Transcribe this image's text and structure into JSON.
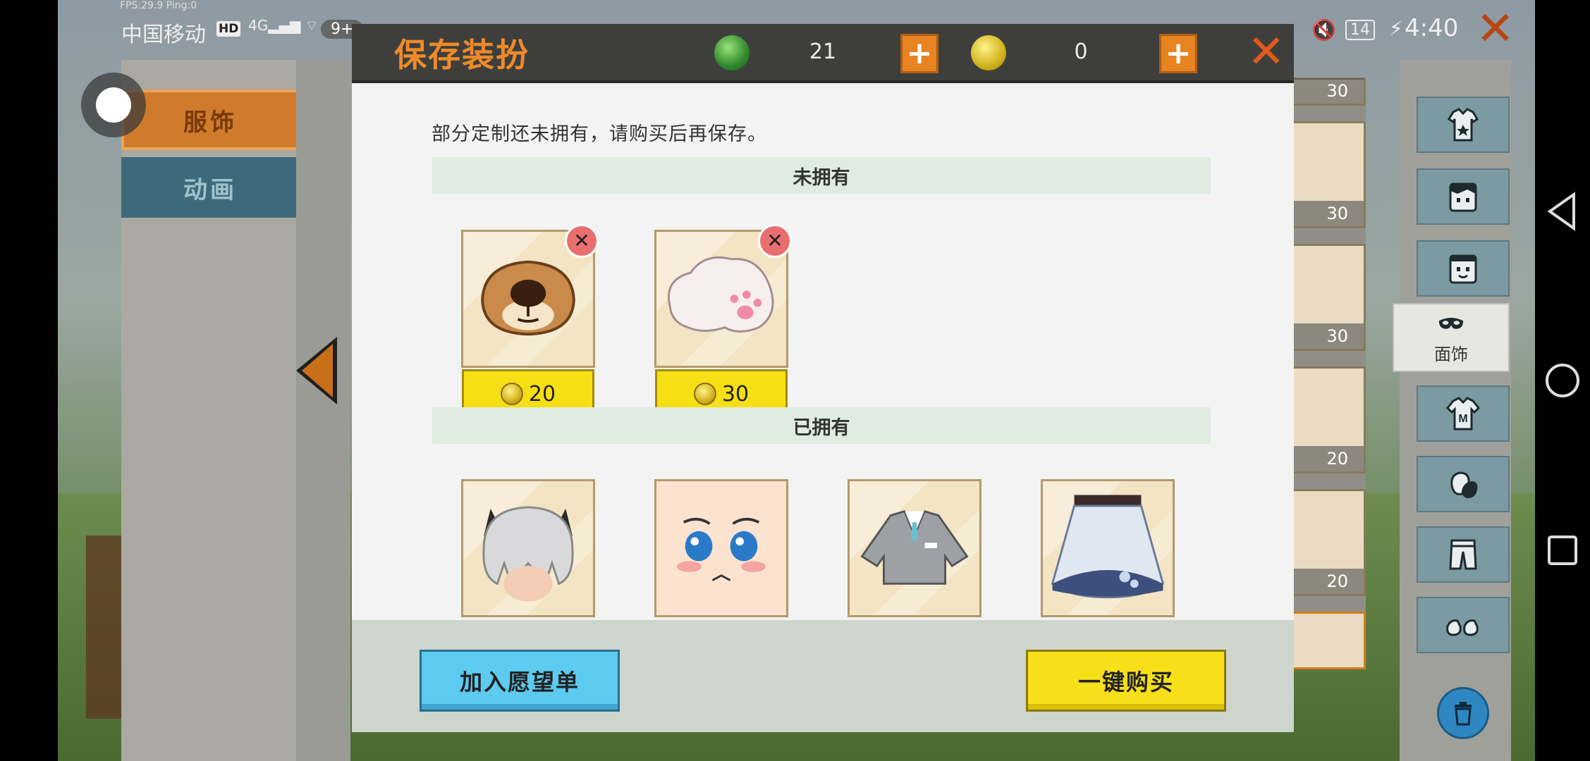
{
  "status_bar": {
    "fps": "FPS:29.9  Ping:0",
    "carrier": "中国移动",
    "hd": "HD",
    "network": "4G",
    "notif_badge": "9+",
    "battery": "14",
    "time": "4:40"
  },
  "left_panel": {
    "tabs": [
      {
        "label": "服饰"
      },
      {
        "label": "动画"
      }
    ]
  },
  "right_panel": {
    "categories": [
      {
        "icon": "outfit-icon"
      },
      {
        "icon": "hair-icon"
      },
      {
        "icon": "face-icon"
      },
      {
        "icon": "mask-icon",
        "label": "面饰",
        "selected": true
      },
      {
        "icon": "shirt-icon"
      },
      {
        "icon": "gloves-icon"
      },
      {
        "icon": "pants-icon"
      },
      {
        "icon": "shoes-icon"
      }
    ],
    "strip_costs": [
      "30",
      "30",
      "30",
      "20",
      "20"
    ]
  },
  "dialog": {
    "title": "保存装扮",
    "gems": "21",
    "coins": "0",
    "notice": "部分定制还未拥有，请购买后再保存。",
    "unowned_header": "未拥有",
    "owned_header": "已拥有",
    "unowned_items": [
      {
        "name": "bear-nose",
        "price": "20"
      },
      {
        "name": "cat-paw",
        "price": "30"
      }
    ],
    "owned_items": [
      {
        "name": "silver-cat-hair"
      },
      {
        "name": "shy-face"
      },
      {
        "name": "gray-uniform-top"
      },
      {
        "name": "floral-skirt"
      }
    ],
    "wishlist_label": "加入愿望单",
    "buy_all_label": "一键购买"
  },
  "colors": {
    "title_orange": "#ef8a2a",
    "price_yellow": "#f6df14",
    "wish_blue": "#5ccbef"
  }
}
